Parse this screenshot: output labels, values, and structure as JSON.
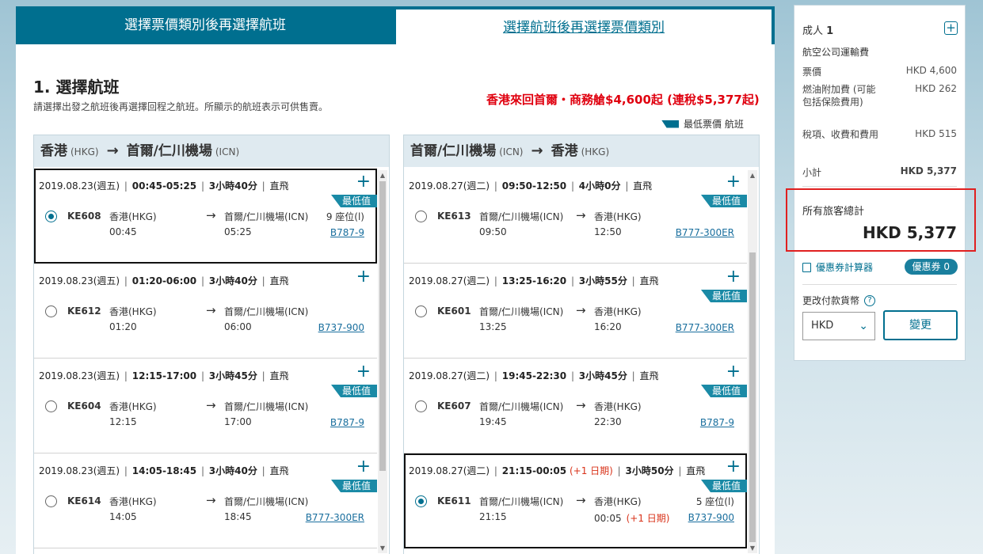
{
  "tabs": {
    "fare_first": "選擇票價類別後再選擇航班",
    "flight_first": "選擇航班後再選擇票價類別"
  },
  "section": {
    "title": "1. 選擇航班",
    "subtitle": "請選擇出發之航班後再選擇回程之航班。所顯示的航班表示可供售賣。",
    "promo": "香港來回首爾・商務艙$4,600起 (連稅$5,377起)",
    "legend": "最低票價 航班"
  },
  "outbound": {
    "origin": "香港",
    "origin_code": "(HKG)",
    "dest": "首爾/仁川機場",
    "dest_code": "(ICN)",
    "flights": [
      {
        "date": "2019.08.23(週五)",
        "time": "00:45-05:25",
        "duration": "3小時40分",
        "type": "直飛",
        "badge": "最低值",
        "no": "KE608",
        "from": "香港(HKG)",
        "to": "首爾/仁川機場(ICN)",
        "dep": "00:45",
        "arr": "05:25",
        "seats": "9 座位(l)",
        "plane": "B787-9"
      },
      {
        "date": "2019.08.23(週五)",
        "time": "01:20-06:00",
        "duration": "3小時40分",
        "type": "直飛",
        "badge": "",
        "no": "KE612",
        "from": "香港(HKG)",
        "to": "首爾/仁川機場(ICN)",
        "dep": "01:20",
        "arr": "06:00",
        "seats": "",
        "plane": "B737-900"
      },
      {
        "date": "2019.08.23(週五)",
        "time": "12:15-17:00",
        "duration": "3小時45分",
        "type": "直飛",
        "badge": "最低值",
        "no": "KE604",
        "from": "香港(HKG)",
        "to": "首爾/仁川機場(ICN)",
        "dep": "12:15",
        "arr": "17:00",
        "seats": "",
        "plane": "B787-9"
      },
      {
        "date": "2019.08.23(週五)",
        "time": "14:05-18:45",
        "duration": "3小時40分",
        "type": "直飛",
        "badge": "最低值",
        "no": "KE614",
        "from": "香港(HKG)",
        "to": "首爾/仁川機場(ICN)",
        "dep": "14:05",
        "arr": "18:45",
        "seats": "",
        "plane": "B777-300ER"
      }
    ]
  },
  "inbound": {
    "origin": "首爾/仁川機場",
    "origin_code": "(ICN)",
    "dest": "香港",
    "dest_code": "(HKG)",
    "flights": [
      {
        "date": "2019.08.27(週二)",
        "time": "09:50-12:50",
        "next_day": "",
        "duration": "4小時0分",
        "type": "直飛",
        "badge": "最低值",
        "no": "KE613",
        "from": "首爾/仁川機場(ICN)",
        "to": "香港(HKG)",
        "dep": "09:50",
        "arr": "12:50",
        "arr_next": "",
        "seats": "",
        "plane": "B777-300ER"
      },
      {
        "date": "2019.08.27(週二)",
        "time": "13:25-16:20",
        "next_day": "",
        "duration": "3小時55分",
        "type": "直飛",
        "badge": "最低值",
        "no": "KE601",
        "from": "首爾/仁川機場(ICN)",
        "to": "香港(HKG)",
        "dep": "13:25",
        "arr": "16:20",
        "arr_next": "",
        "seats": "",
        "plane": "B777-300ER"
      },
      {
        "date": "2019.08.27(週二)",
        "time": "19:45-22:30",
        "next_day": "",
        "duration": "3小時45分",
        "type": "直飛",
        "badge": "最低值",
        "no": "KE607",
        "from": "首爾/仁川機場(ICN)",
        "to": "香港(HKG)",
        "dep": "19:45",
        "arr": "22:30",
        "arr_next": "",
        "seats": "",
        "plane": "B787-9"
      },
      {
        "date": "2019.08.27(週二)",
        "time": "21:15-00:05",
        "next_day": "(+1 日期)",
        "duration": "3小時50分",
        "type": "直飛",
        "badge": "最低值",
        "no": "KE611",
        "from": "首爾/仁川機場(ICN)",
        "to": "香港(HKG)",
        "dep": "21:15",
        "arr": "00:05",
        "arr_next": "(+1 日期)",
        "seats": "5 座位(l)",
        "plane": "B737-900"
      }
    ]
  },
  "summary": {
    "adults": "成人",
    "adults_count": "1",
    "airline_fare": "航空公司運輸費",
    "fare_label": "票價",
    "fare_value": "HKD 4,600",
    "fuel_label": "燃油附加費 (可能包括保險費用)",
    "fuel_value": "HKD 262",
    "tax_label": "稅項、收費和費用",
    "tax_value": "HKD 515",
    "subtotal_label": "小計",
    "subtotal_value": "HKD 5,377",
    "total_label": "所有旅客總計",
    "total_value": "HKD 5,377",
    "calc_label": "優惠券計算器",
    "coupon_label": "優惠券 0",
    "currency_label": "更改付款貨幣",
    "currency_value": "HKD",
    "change_button": "變更"
  },
  "colors": {
    "brand": "#006f8f",
    "badge": "#1a8aa6",
    "promo": "#e0000f",
    "next_day": "#d9331a",
    "highlight_box": "#e02020"
  },
  "icons": {
    "plus": "plus-icon",
    "arrow": "arrow-right-icon",
    "calculator": "calculator-icon",
    "help": "help-icon",
    "chevron": "chevron-down-icon"
  }
}
